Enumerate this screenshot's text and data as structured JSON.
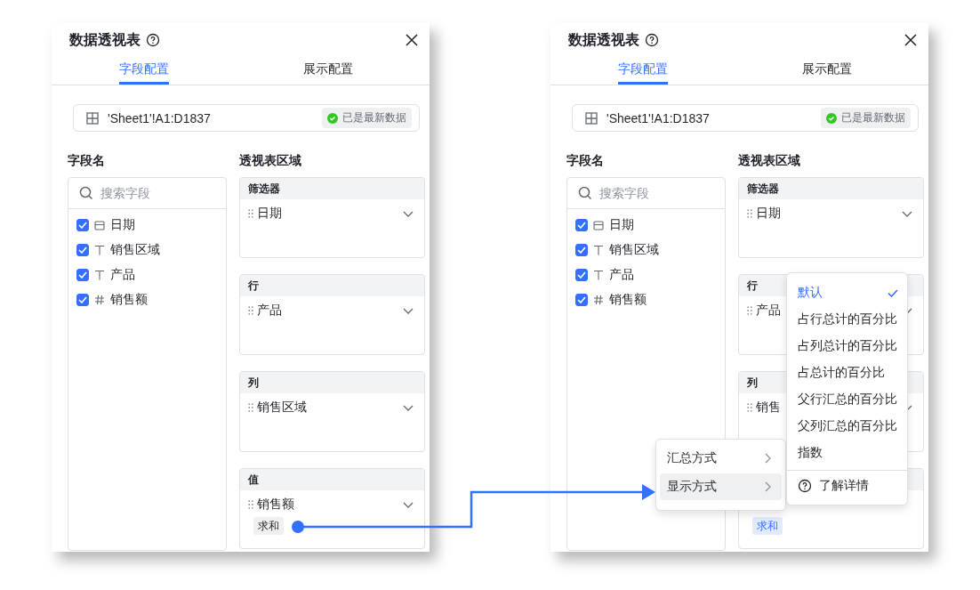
{
  "panels": [
    {
      "title": "数据透视表",
      "tabs": [
        {
          "label": "字段配置",
          "selected": true
        },
        {
          "label": "展示配置",
          "selected": false
        }
      ],
      "source": {
        "range": "'Sheet1'!A1:D1837",
        "status": "已是最新数据"
      },
      "fields_heading": "字段名",
      "search": {
        "placeholder": "搜索字段"
      },
      "fields": [
        {
          "label": "日期",
          "kind": "date",
          "checked": true
        },
        {
          "label": "销售区域",
          "kind": "text",
          "checked": true
        },
        {
          "label": "产品",
          "kind": "text",
          "checked": true
        },
        {
          "label": "销售额",
          "kind": "number",
          "checked": true
        }
      ],
      "areas_heading": "透视表区域",
      "zones": [
        {
          "header": "筛选器",
          "items": [
            {
              "label": "日期"
            }
          ]
        },
        {
          "header": "行",
          "items": [
            {
              "label": "产品"
            }
          ]
        },
        {
          "header": "列",
          "items": [
            {
              "label": "销售区域"
            }
          ]
        },
        {
          "header": "值",
          "items": [
            {
              "label": "销售额",
              "tags": [
                {
                  "label": "求和",
                  "selected": false
                }
              ]
            }
          ]
        }
      ]
    },
    {
      "title": "数据透视表",
      "tabs": [
        {
          "label": "字段配置",
          "selected": true
        },
        {
          "label": "展示配置",
          "selected": false
        }
      ],
      "source": {
        "range": "'Sheet1'!A1:D1837",
        "status": "已是最新数据"
      },
      "fields_heading": "字段名",
      "search": {
        "placeholder": "搜索字段"
      },
      "fields": [
        {
          "label": "日期",
          "kind": "date",
          "checked": true
        },
        {
          "label": "销售区域",
          "kind": "text",
          "checked": true
        },
        {
          "label": "产品",
          "kind": "text",
          "checked": true
        },
        {
          "label": "销售额",
          "kind": "number",
          "checked": true
        }
      ],
      "areas_heading": "透视表区域",
      "zones": [
        {
          "header": "筛选器",
          "items": [
            {
              "label": "日期"
            }
          ]
        },
        {
          "header": "行",
          "items": [
            {
              "label": "产品"
            }
          ]
        },
        {
          "header": "列",
          "items": [
            {
              "label": "销售"
            }
          ]
        },
        {
          "items": [
            {
              "tags": [
                {
                  "label": "求和",
                  "selected": true
                }
              ]
            }
          ]
        }
      ],
      "submenu": {
        "items": [
          {
            "label": "汇总方式",
            "selected": false
          },
          {
            "label": "显示方式",
            "selected": true
          }
        ]
      },
      "display_menu": {
        "items": [
          {
            "label": "默认",
            "selected": true
          },
          {
            "label": "占行总计的百分比",
            "selected": false
          },
          {
            "label": "占列总计的百分比",
            "selected": false
          },
          {
            "label": "占总计的百分比",
            "selected": false
          },
          {
            "label": "父行汇总的百分比",
            "selected": false
          },
          {
            "label": "父列汇总的百分比",
            "selected": false
          },
          {
            "label": "指数",
            "selected": false
          }
        ],
        "help": "了解详情"
      }
    }
  ]
}
